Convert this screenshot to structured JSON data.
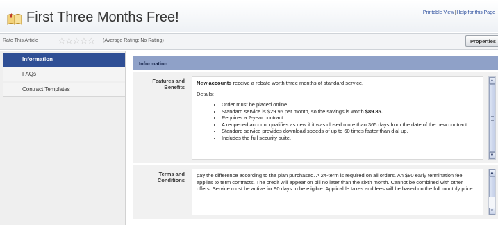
{
  "header": {
    "title": "First Three Months Free!",
    "printable_link": "Printable View",
    "separator": "|",
    "help_link": "Help for this Page",
    "book_icon": "book-icon"
  },
  "rating": {
    "label": "Rate This Article",
    "stars": [
      "☆",
      "☆",
      "☆",
      "☆",
      "☆"
    ],
    "average": "(Average Rating: No Rating)"
  },
  "toolbar": {
    "properties_label": "Properties"
  },
  "sidebar": {
    "items": [
      {
        "label": "Information",
        "active": true
      },
      {
        "label": "FAQs",
        "active": false
      },
      {
        "label": "Contract Templates",
        "active": false
      }
    ]
  },
  "main": {
    "section_title": "Information",
    "features": {
      "label": "Features and Benefits",
      "intro_bold": "New accounts",
      "intro_rest": " receive a rebate worth three months of standard service.",
      "details_label": "Details:",
      "bullets": [
        "Order must be placed online.",
        "Standard service is $29.95 per month, so the savings is worth ",
        "Requires a 2-year contract.",
        "A reopened account qualifies as new if it was closed more than 365 days from the date of the new contract.",
        "Standard service provides download speeds of up to 60 times faster than dial up.",
        "Includes the full security suite."
      ],
      "savings_bold": "$89.85."
    },
    "terms": {
      "label": "Terms and Conditions",
      "text": "pay the difference according to the plan purchased. A 24-term is required on all orders. An $80 early termination fee applies to term contracts. The credit will appear on bill no later than the sixth month. Cannot be combined with other offers. Service must be active for 90 days to be eligible. Applicable taxes and fees will be based on the full monthly price."
    }
  },
  "colors": {
    "accent": "#2f4f95",
    "section_header": "#8fa1c8",
    "link": "#2d4f9e"
  }
}
